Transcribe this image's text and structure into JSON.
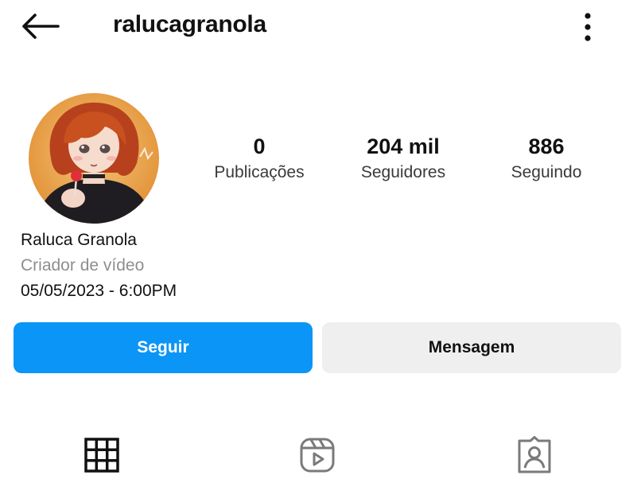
{
  "header": {
    "back_icon": "arrow-left-icon",
    "username": "ralucagranola",
    "more_icon": "vertical-dots-icon"
  },
  "profile": {
    "avatar": "profile-avatar",
    "name": "Raluca Granola",
    "category": "Criador de vídeo",
    "date": "05/05/2023 - 6:00PM"
  },
  "stats": [
    {
      "value": "0",
      "label": "Publicações"
    },
    {
      "value": "204 mil",
      "label": "Seguidores"
    },
    {
      "value": "886",
      "label": "Seguindo"
    }
  ],
  "actions": {
    "follow_label": "Seguir",
    "message_label": "Mensagem"
  },
  "tabs": [
    {
      "icon": "grid-icon",
      "active": true
    },
    {
      "icon": "reels-icon",
      "active": false
    },
    {
      "icon": "tagged-icon",
      "active": false
    }
  ],
  "colors": {
    "primary_blue": "#0b95f6",
    "secondary_button": "#efefef",
    "muted_text": "#8e8e8e"
  }
}
